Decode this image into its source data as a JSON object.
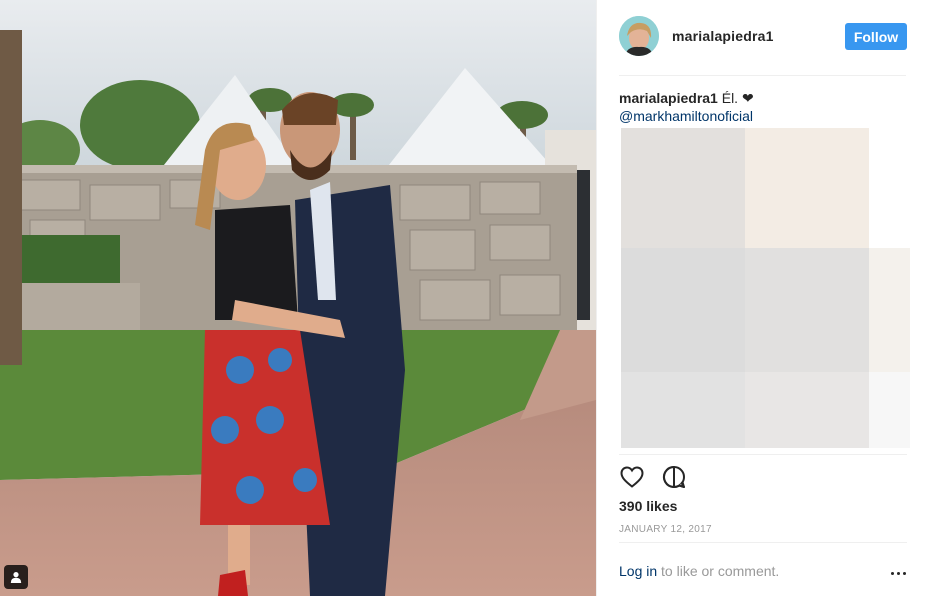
{
  "post": {
    "username": "marialapiedra1",
    "follow_label": "Follow",
    "caption_user": "marialapiedra1",
    "caption_text": " Él. ❤",
    "caption_mention": "@markhamiltonoficial",
    "likes": "390 likes",
    "date": "JANUARY 12, 2017",
    "login_link": "Log in",
    "login_suffix": " to like or comment."
  },
  "icons": {
    "like": "heart-icon",
    "comment": "comment-icon",
    "more": "more-options-icon",
    "tag": "user-tag-icon"
  },
  "colors": {
    "follow_button": "#3897f0",
    "link": "#003569",
    "muted": "#999999",
    "text": "#262626",
    "divider": "#efefef"
  }
}
